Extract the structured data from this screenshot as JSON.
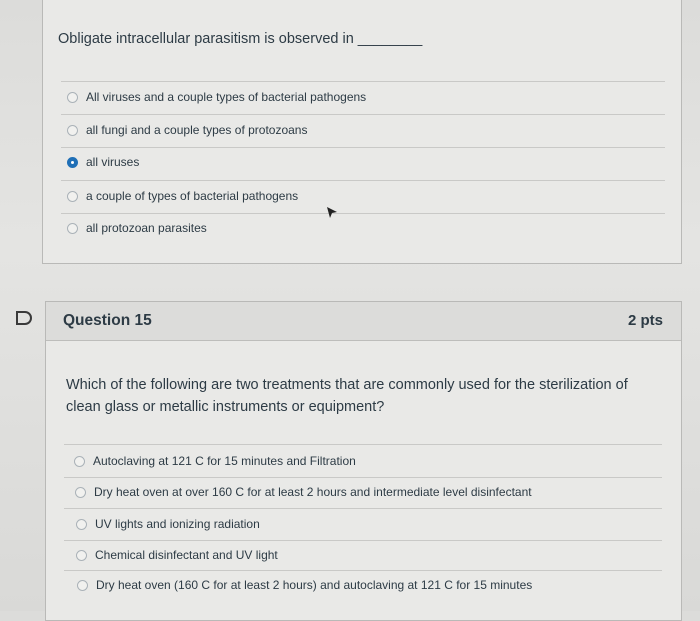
{
  "q14": {
    "question_text": "Obligate intracellular parasitism is observed in ________",
    "options": [
      "All viruses and a couple types of bacterial pathogens",
      "all fungi and a couple types of protozoans",
      "all viruses",
      "a couple of types of bacterial pathogens",
      "all protozoan parasites"
    ],
    "selected_index": 2
  },
  "q15": {
    "title": "Question 15",
    "points": "2 pts",
    "question_text": "Which of the following are two treatments that are commonly used for the sterilization of clean glass or metallic instruments or equipment?",
    "options": [
      "Autoclaving at 121 C for 15 minutes and Filtration",
      "Dry heat oven at over 160 C for at least 2 hours and intermediate level disinfectant",
      "UV lights and ionizing radiation",
      "Chemical disinfectant and UV light",
      "Dry heat oven (160 C for at least 2 hours) and autoclaving at 121 C for 15 minutes"
    ]
  },
  "colors": {
    "accent": "#1f6fb6",
    "text": "#2d3b45"
  },
  "icons": {
    "flag": "bookmark-flag-icon",
    "cursor": "mouse-pointer-icon"
  }
}
